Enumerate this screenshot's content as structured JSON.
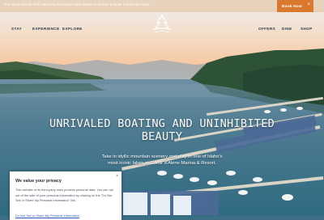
{
  "topbar": {
    "text": "Our Pend Oreille Fish Hatchery Extended Sale Dates! Call Now & Book 1-208-555-0100",
    "book_label": "Book Now",
    "close": "×"
  },
  "nav": {
    "left": [
      "STAY",
      "EXPERIENCE",
      "EXPLORE"
    ],
    "right": [
      "OFFERS",
      "DINE",
      "SHOP"
    ]
  },
  "hero": {
    "headline_line1": "UNRIVALED BOATING AND UNINHIBITED",
    "headline_line2": "BEAUTY",
    "sub_line1": "Take in idyllic mountain scenery and play in one of Idaho's",
    "sub_line2": "most iconic lakes at Coeur d'Alene Marina & Resort."
  },
  "privacy": {
    "title": "We value your privacy",
    "body": "This website or its third-party tools process personal data. You can opt out of the sale of your personal information by clicking on the \"Do Not Sell or Share My Personal Information\" link.",
    "link": "Do Not Sell or Share My Personal Information",
    "close": "×"
  },
  "colors": {
    "accent": "#d9782e",
    "nav_text": "#2b3a4a"
  }
}
